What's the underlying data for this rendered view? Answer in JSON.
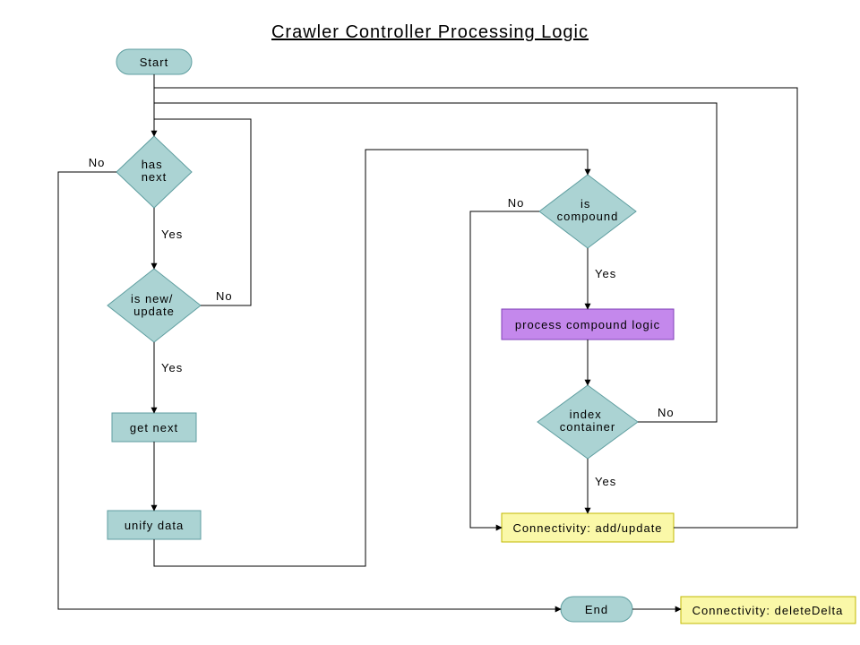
{
  "title": "Crawler Controller Processing Logic",
  "nodes": {
    "start": "Start",
    "hasNext": "has\nnext",
    "isNew": "is new/\nupdate",
    "getNext": "get next",
    "unifyData": "unify data",
    "isCompound": "is\ncompound",
    "processCompound": "process compound logic",
    "indexContainer": "index\ncontainer",
    "connAdd": "Connectivity: add/update",
    "end": "End",
    "connDelete": "Connectivity: deleteDelta"
  },
  "labels": {
    "yes": "Yes",
    "no": "No"
  },
  "colors": {
    "teal": "#ABD3D3",
    "tealStroke": "#5F9EA0",
    "purple": "#C488EC",
    "purpleStroke": "#8040B8",
    "yellow": "#FAF8A8",
    "yellowStroke": "#C2B900",
    "line": "#000000"
  }
}
